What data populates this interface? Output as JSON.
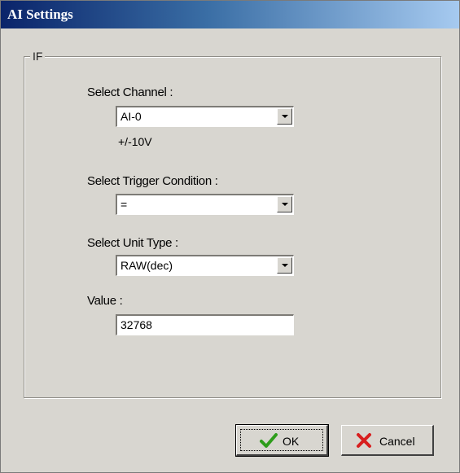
{
  "window": {
    "title": "AI Settings"
  },
  "group": {
    "title": "IF",
    "channel": {
      "label": "Select Channel :",
      "value": "AI-0",
      "range": "+/-10V"
    },
    "trigger": {
      "label": "Select Trigger Condition :",
      "value": "="
    },
    "unit": {
      "label": "Select Unit Type :",
      "value": "RAW(dec)"
    },
    "value": {
      "label": "Value :",
      "value": "32768"
    }
  },
  "buttons": {
    "ok_label": "OK",
    "cancel_label": "Cancel"
  },
  "icons": {
    "ok": "checkmark-icon",
    "cancel": "x-mark-icon",
    "dropdown": "chevron-down-icon"
  },
  "colors": {
    "title_bar": "#0a246a",
    "ok_icon": "#2e9d1b",
    "cancel_icon": "#d81e1e",
    "dialog_bg": "#d8d6d0"
  }
}
